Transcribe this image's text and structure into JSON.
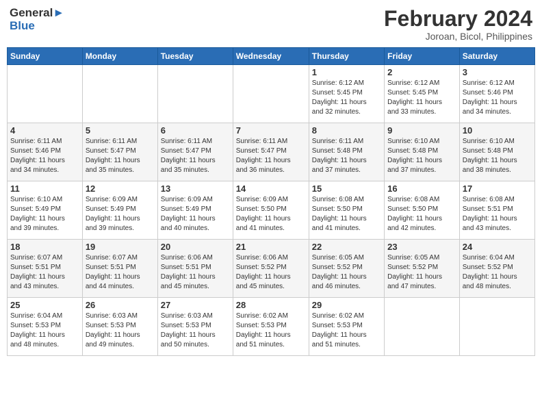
{
  "logo": {
    "line1": "General",
    "line2": "Blue"
  },
  "title": "February 2024",
  "location": "Joroan, Bicol, Philippines",
  "headers": [
    "Sunday",
    "Monday",
    "Tuesday",
    "Wednesday",
    "Thursday",
    "Friday",
    "Saturday"
  ],
  "weeks": [
    [
      {
        "day": "",
        "info": ""
      },
      {
        "day": "",
        "info": ""
      },
      {
        "day": "",
        "info": ""
      },
      {
        "day": "",
        "info": ""
      },
      {
        "day": "1",
        "info": "Sunrise: 6:12 AM\nSunset: 5:45 PM\nDaylight: 11 hours\nand 32 minutes."
      },
      {
        "day": "2",
        "info": "Sunrise: 6:12 AM\nSunset: 5:45 PM\nDaylight: 11 hours\nand 33 minutes."
      },
      {
        "day": "3",
        "info": "Sunrise: 6:12 AM\nSunset: 5:46 PM\nDaylight: 11 hours\nand 34 minutes."
      }
    ],
    [
      {
        "day": "4",
        "info": "Sunrise: 6:11 AM\nSunset: 5:46 PM\nDaylight: 11 hours\nand 34 minutes."
      },
      {
        "day": "5",
        "info": "Sunrise: 6:11 AM\nSunset: 5:47 PM\nDaylight: 11 hours\nand 35 minutes."
      },
      {
        "day": "6",
        "info": "Sunrise: 6:11 AM\nSunset: 5:47 PM\nDaylight: 11 hours\nand 35 minutes."
      },
      {
        "day": "7",
        "info": "Sunrise: 6:11 AM\nSunset: 5:47 PM\nDaylight: 11 hours\nand 36 minutes."
      },
      {
        "day": "8",
        "info": "Sunrise: 6:11 AM\nSunset: 5:48 PM\nDaylight: 11 hours\nand 37 minutes."
      },
      {
        "day": "9",
        "info": "Sunrise: 6:10 AM\nSunset: 5:48 PM\nDaylight: 11 hours\nand 37 minutes."
      },
      {
        "day": "10",
        "info": "Sunrise: 6:10 AM\nSunset: 5:48 PM\nDaylight: 11 hours\nand 38 minutes."
      }
    ],
    [
      {
        "day": "11",
        "info": "Sunrise: 6:10 AM\nSunset: 5:49 PM\nDaylight: 11 hours\nand 39 minutes."
      },
      {
        "day": "12",
        "info": "Sunrise: 6:09 AM\nSunset: 5:49 PM\nDaylight: 11 hours\nand 39 minutes."
      },
      {
        "day": "13",
        "info": "Sunrise: 6:09 AM\nSunset: 5:49 PM\nDaylight: 11 hours\nand 40 minutes."
      },
      {
        "day": "14",
        "info": "Sunrise: 6:09 AM\nSunset: 5:50 PM\nDaylight: 11 hours\nand 41 minutes."
      },
      {
        "day": "15",
        "info": "Sunrise: 6:08 AM\nSunset: 5:50 PM\nDaylight: 11 hours\nand 41 minutes."
      },
      {
        "day": "16",
        "info": "Sunrise: 6:08 AM\nSunset: 5:50 PM\nDaylight: 11 hours\nand 42 minutes."
      },
      {
        "day": "17",
        "info": "Sunrise: 6:08 AM\nSunset: 5:51 PM\nDaylight: 11 hours\nand 43 minutes."
      }
    ],
    [
      {
        "day": "18",
        "info": "Sunrise: 6:07 AM\nSunset: 5:51 PM\nDaylight: 11 hours\nand 43 minutes."
      },
      {
        "day": "19",
        "info": "Sunrise: 6:07 AM\nSunset: 5:51 PM\nDaylight: 11 hours\nand 44 minutes."
      },
      {
        "day": "20",
        "info": "Sunrise: 6:06 AM\nSunset: 5:51 PM\nDaylight: 11 hours\nand 45 minutes."
      },
      {
        "day": "21",
        "info": "Sunrise: 6:06 AM\nSunset: 5:52 PM\nDaylight: 11 hours\nand 45 minutes."
      },
      {
        "day": "22",
        "info": "Sunrise: 6:05 AM\nSunset: 5:52 PM\nDaylight: 11 hours\nand 46 minutes."
      },
      {
        "day": "23",
        "info": "Sunrise: 6:05 AM\nSunset: 5:52 PM\nDaylight: 11 hours\nand 47 minutes."
      },
      {
        "day": "24",
        "info": "Sunrise: 6:04 AM\nSunset: 5:52 PM\nDaylight: 11 hours\nand 48 minutes."
      }
    ],
    [
      {
        "day": "25",
        "info": "Sunrise: 6:04 AM\nSunset: 5:53 PM\nDaylight: 11 hours\nand 48 minutes."
      },
      {
        "day": "26",
        "info": "Sunrise: 6:03 AM\nSunset: 5:53 PM\nDaylight: 11 hours\nand 49 minutes."
      },
      {
        "day": "27",
        "info": "Sunrise: 6:03 AM\nSunset: 5:53 PM\nDaylight: 11 hours\nand 50 minutes."
      },
      {
        "day": "28",
        "info": "Sunrise: 6:02 AM\nSunset: 5:53 PM\nDaylight: 11 hours\nand 51 minutes."
      },
      {
        "day": "29",
        "info": "Sunrise: 6:02 AM\nSunset: 5:53 PM\nDaylight: 11 hours\nand 51 minutes."
      },
      {
        "day": "",
        "info": ""
      },
      {
        "day": "",
        "info": ""
      }
    ]
  ]
}
